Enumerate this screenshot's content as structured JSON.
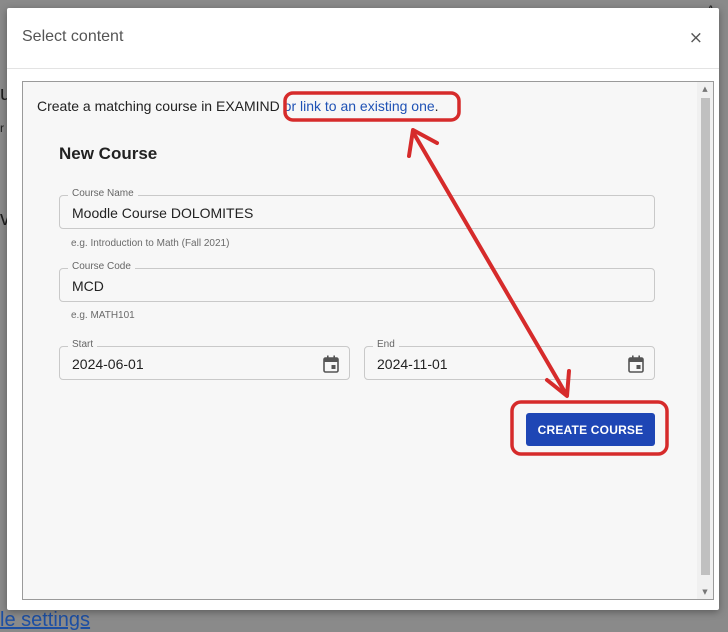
{
  "background": {
    "fragment_u": "u",
    "fragment_r": "r",
    "fragment_v": "v",
    "bottom_link": "le settings",
    "corner_char": "A"
  },
  "modal": {
    "title": "Select content",
    "close_glyph": "×"
  },
  "content": {
    "intro_text": "Create a matching course in EXAMIND ",
    "intro_link": "or link to an existing one",
    "intro_period": ".",
    "form_title": "New Course",
    "fields": {
      "course_name": {
        "label": "Course Name",
        "value": "Moodle Course DOLOMITES",
        "helper": "e.g. Introduction to Math (Fall 2021)"
      },
      "course_code": {
        "label": "Course Code",
        "value": "MCD",
        "helper": "e.g. MATH101"
      },
      "start": {
        "label": "Start",
        "value": "2024-06-01"
      },
      "end": {
        "label": "End",
        "value": "2024-11-01"
      }
    },
    "create_button": "CREATE COURSE"
  },
  "scrollbar": {
    "up": "▲",
    "down": "▼"
  },
  "icons": {
    "calendar": "calendar-icon",
    "close": "close-icon"
  },
  "colors": {
    "accent": "#1e46b5",
    "link": "#1f52b5",
    "annotation": "#d62b2b"
  }
}
